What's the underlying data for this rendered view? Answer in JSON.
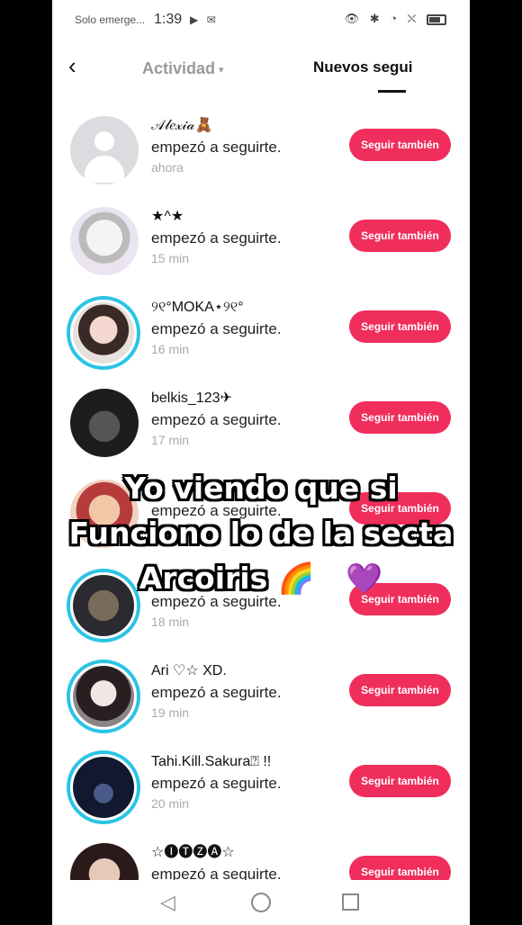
{
  "status_bar": {
    "carrier": "Solo emerge...",
    "time": "1:39",
    "notif_icons": "▶ ✉",
    "right_icons": "👁 ✱ ◔ ⛌"
  },
  "header": {
    "back_icon": "‹",
    "activity_tab": "Actividad",
    "activity_caret": "▾",
    "new_followers_tab": "Nuevos segui"
  },
  "follow_button_label": "Seguir también",
  "items": [
    {
      "username": "𝒜𝓁𝑒𝓍𝒾𝒶🧸",
      "action": "empezó a seguirte.",
      "time": "ahora"
    },
    {
      "username": "★^★",
      "action": "empezó a seguirte.",
      "time": "15 min"
    },
    {
      "username": "୨୧°MOKA⋆୨୧°",
      "action": "empezó a seguirte.",
      "time": "16 min"
    },
    {
      "username": "belkis_123✈",
      "action": "empezó a seguirte.",
      "time": "17 min"
    },
    {
      "username": "",
      "action": "empezó a seguirte.",
      "time": ""
    },
    {
      "username": "",
      "action": "empezó a seguirte.",
      "time": "18 min"
    },
    {
      "username": "Ari ♡☆ XD.",
      "action": "empezó a seguirte.",
      "time": "19 min"
    },
    {
      "username": "Tahi.Kill.Sakura⍰ !!",
      "action": "empezó a seguirte.",
      "time": "20 min"
    },
    {
      "username": "☆🅘🅣🅩🅐☆",
      "action": "empezó a seguirte.",
      "time": ""
    }
  ],
  "caption": {
    "line1": "Yo viendo que si",
    "line2": "Funciono lo de la secta",
    "line3": "Arcoiris",
    "emojis": "🌈😳💜"
  },
  "nav": {
    "back_icon": "◁"
  }
}
